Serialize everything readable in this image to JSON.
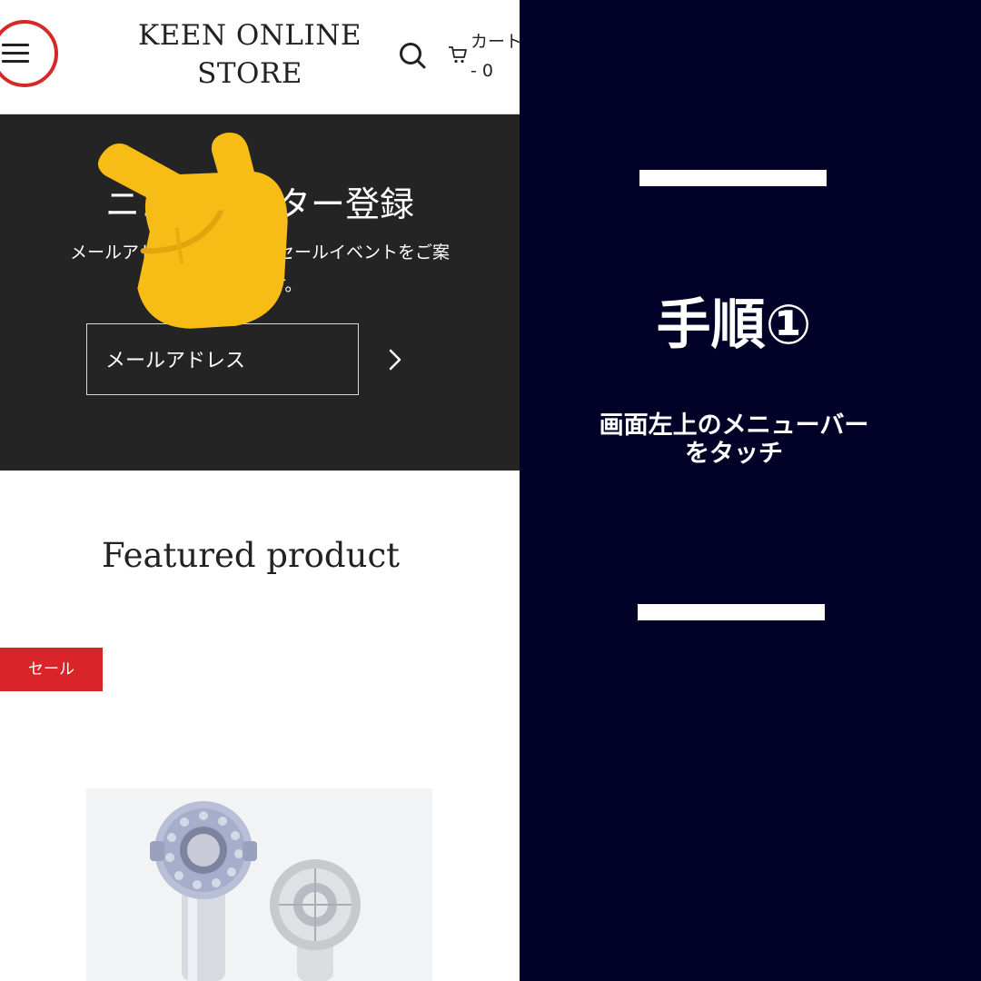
{
  "header": {
    "store_title": "KEEN ONLINE STORE",
    "cart_label": "カート - 0"
  },
  "newsletter": {
    "title": "ニュースレター登録",
    "description": "メールアドレスで新商品、セールイベントをご案\n内します。",
    "email_placeholder": "メールアドレス"
  },
  "featured": {
    "title": "Featured product",
    "sale_badge": "セール"
  },
  "instruction": {
    "step_title": "手順①",
    "step_description": "画面左上のメニューバー\nをタッチ"
  },
  "colors": {
    "panel_bg": "#020229",
    "newsletter_bg": "#242424",
    "sale_red": "#d9252a",
    "highlight_circle": "#d62828",
    "hand_yellow": "#f7bd16"
  },
  "icons": [
    "menu-icon",
    "search-icon",
    "cart-icon",
    "chevron-right-icon",
    "pointing-hand-icon"
  ]
}
